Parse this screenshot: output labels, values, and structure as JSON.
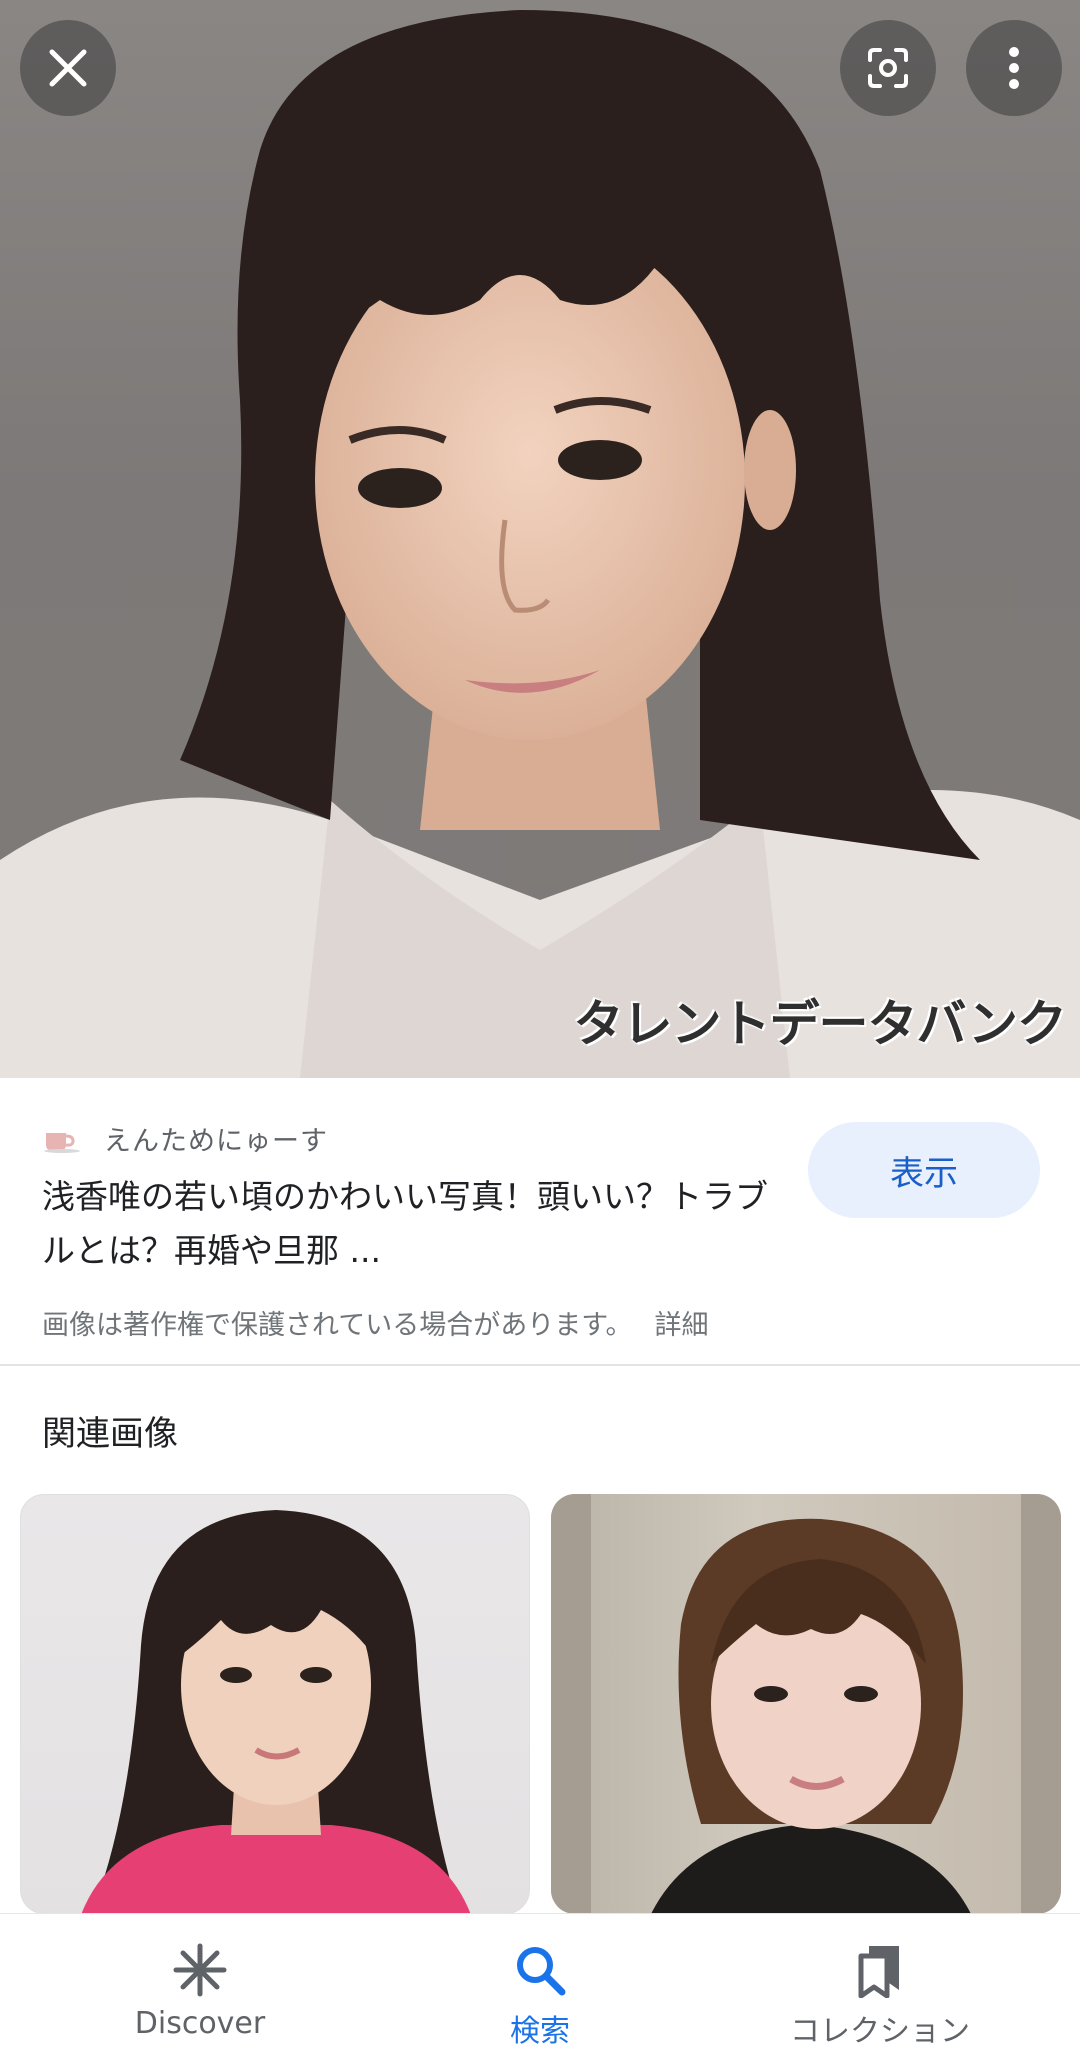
{
  "hero": {
    "watermark": "タレントデータバンク"
  },
  "source": {
    "site_name": "えんためにゅーす",
    "title": "浅香唯の若い頃のかわいい写真！頭いい？トラブルとは？再婚や旦那 ...",
    "view_button": "表示",
    "copyright_notice": "画像は著作権で保護されている場合があります。",
    "copyright_detail": "詳細"
  },
  "related": {
    "heading": "関連画像"
  },
  "bottom_nav": {
    "items": [
      {
        "label": "Discover",
        "icon": "discover-asterisk-icon",
        "active": false
      },
      {
        "label": "検索",
        "icon": "search-icon",
        "active": true
      },
      {
        "label": "コレクション",
        "icon": "collections-bookmark-icon",
        "active": false
      }
    ]
  },
  "colors": {
    "accent": "#1a73e8",
    "button_bg": "#e8f0fe",
    "secondary_text": "#5f6368"
  }
}
